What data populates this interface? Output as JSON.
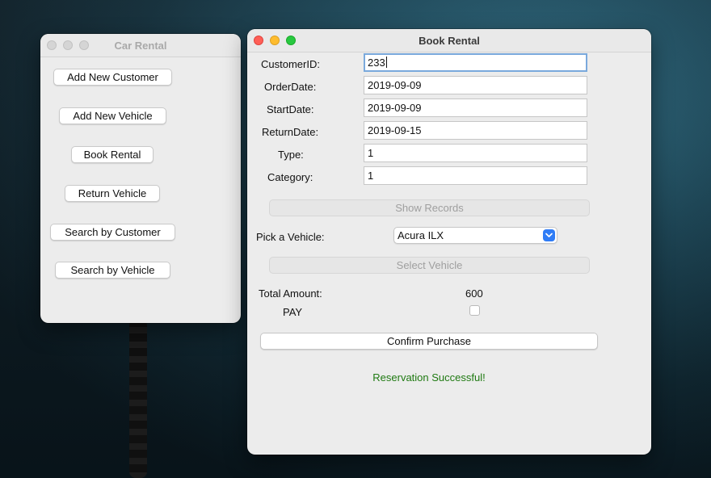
{
  "left_window": {
    "title": "Car Rental",
    "buttons": [
      "Add New Customer",
      "Add New Vehicle",
      "Book Rental",
      "Return Vehicle",
      "Search by Customer",
      "Search by Vehicle"
    ]
  },
  "right_window": {
    "title": "Book Rental",
    "form": {
      "customer_id": {
        "label": "CustomerID:",
        "value": "233"
      },
      "order_date": {
        "label": "OrderDate:",
        "value": "2019-09-09"
      },
      "start_date": {
        "label": "StartDate:",
        "value": "2019-09-09"
      },
      "return_date": {
        "label": "ReturnDate:",
        "value": "2019-09-15"
      },
      "type": {
        "label": "Type:",
        "value": "1"
      },
      "category": {
        "label": "Category:",
        "value": "1"
      }
    },
    "show_records_label": "Show Records",
    "pick_vehicle_label": "Pick a Vehicle:",
    "vehicle_selected": "Acura ILX",
    "select_vehicle_label": "Select Vehicle",
    "total_amount_label": "Total Amount:",
    "total_amount_value": "600",
    "pay_label": "PAY",
    "pay_checked": false,
    "confirm_label": "Confirm Purchase",
    "status_message": "Reservation Successful!",
    "status_color": "#1f7a12"
  }
}
